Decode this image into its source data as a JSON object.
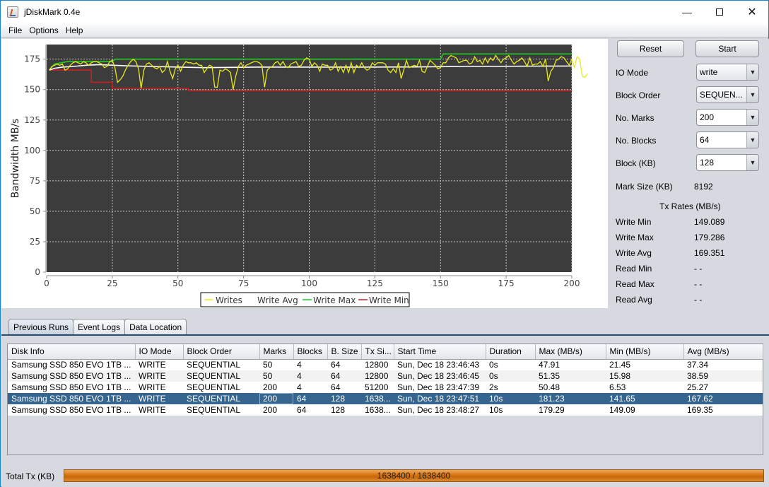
{
  "window": {
    "title": "jDiskMark 0.4e",
    "controls": [
      "minimize",
      "maximize",
      "close"
    ]
  },
  "menu": [
    "File",
    "Options",
    "Help"
  ],
  "controls": {
    "reset_label": "Reset",
    "start_label": "Start",
    "io_mode": {
      "label": "IO Mode",
      "value": "write"
    },
    "block_order": {
      "label": "Block Order",
      "value": "SEQUEN..."
    },
    "no_marks": {
      "label": "No. Marks",
      "value": "200"
    },
    "no_blocks": {
      "label": "No. Blocks",
      "value": "64"
    },
    "block_kb": {
      "label": "Block (KB)",
      "value": "128"
    },
    "mark_size": {
      "label": "Mark Size (KB)",
      "value": "8192"
    },
    "tx_rates_title": "Tx Rates (MB/s)",
    "rates": [
      {
        "label": "Write Min",
        "value": "149.089"
      },
      {
        "label": "Write Max",
        "value": "179.286"
      },
      {
        "label": "Write Avg",
        "value": "169.351"
      },
      {
        "label": "Read Min",
        "value": "- -"
      },
      {
        "label": "Read Max",
        "value": "- -"
      },
      {
        "label": "Read Avg",
        "value": "- -"
      }
    ]
  },
  "tabs": [
    {
      "label": "Previous Runs",
      "active": true
    },
    {
      "label": "Event Logs",
      "active": false
    },
    {
      "label": "Data Location",
      "active": false
    }
  ],
  "table": {
    "columns": [
      "Disk Info",
      "IO Mode",
      "Block Order",
      "Marks",
      "Blocks",
      "B. Size",
      "Tx Si...",
      "Start Time",
      "Duration",
      "Max (MB/s)",
      "Min (MB/s)",
      "Avg (MB/s)"
    ],
    "rows": [
      [
        "Samsung SSD 850 EVO 1TB ...",
        "WRITE",
        "SEQUENTIAL",
        "50",
        "4",
        "64",
        "12800",
        "Sun, Dec 18 23:46:43",
        "0s",
        "47.91",
        "21.45",
        "37.34"
      ],
      [
        "Samsung SSD 850 EVO 1TB ...",
        "WRITE",
        "SEQUENTIAL",
        "50",
        "4",
        "64",
        "12800",
        "Sun, Dec 18 23:46:45",
        "0s",
        "51.35",
        "15.98",
        "38.59"
      ],
      [
        "Samsung SSD 850 EVO 1TB ...",
        "WRITE",
        "SEQUENTIAL",
        "200",
        "4",
        "64",
        "51200",
        "Sun, Dec 18 23:47:39",
        "2s",
        "50.48",
        "6.53",
        "25.27"
      ],
      [
        "Samsung SSD 850 EVO 1TB ...",
        "WRITE",
        "SEQUENTIAL",
        "200",
        "64",
        "128",
        "1638...",
        "Sun, Dec 18 23:47:51",
        "10s",
        "181.23",
        "141.65",
        "167.62"
      ],
      [
        "Samsung SSD 850 EVO 1TB ...",
        "WRITE",
        "SEQUENTIAL",
        "200",
        "64",
        "128",
        "1638...",
        "Sun, Dec 18 23:48:27",
        "10s",
        "179.29",
        "149.09",
        "169.35"
      ]
    ],
    "selected_row": 3
  },
  "footer": {
    "total_label": "Total Tx (KB)",
    "progress_text": "1638400 / 1638400",
    "progress_fraction": 1.0
  },
  "colors": {
    "plot_bg": "#3c3c3c",
    "writes": "#e8e81c",
    "avg": "#ffffff",
    "max": "#22cc22",
    "min": "#cc1f1f",
    "selection": "#36658f",
    "progress": "#d5730f"
  },
  "chart_data": {
    "type": "line",
    "title": "",
    "xlabel": "",
    "ylabel": "Bandwidth MB/s",
    "xlim": [
      0,
      200
    ],
    "ylim": [
      0,
      187
    ],
    "xticks": [
      0,
      25,
      50,
      75,
      100,
      125,
      150,
      175,
      200
    ],
    "yticks": [
      0,
      25,
      50,
      75,
      100,
      125,
      150,
      175
    ],
    "grid": true,
    "legend": {
      "placement": "bottom-center",
      "entries": [
        "Writes",
        "Write Avg",
        "Write Max",
        "Write Min"
      ]
    },
    "series": [
      {
        "name": "Writes",
        "x_start": 1,
        "values": [
          166,
          169,
          170,
          171,
          170,
          171,
          166,
          167,
          170,
          172,
          173,
          172,
          171,
          173,
          172,
          170,
          172,
          173,
          173,
          172,
          171,
          168,
          169,
          173,
          174,
          168,
          156,
          158,
          161,
          166,
          170,
          173,
          175,
          173,
          167,
          151,
          166,
          171,
          172,
          170,
          168,
          167,
          169,
          164,
          166,
          173,
          165,
          159,
          167,
          170,
          165,
          170,
          173,
          172,
          172,
          171,
          172,
          170,
          170,
          164,
          167,
          170,
          169,
          152,
          152,
          166,
          165,
          167,
          166,
          164,
          150,
          161,
          169,
          172,
          168,
          170,
          171,
          172,
          173,
          173,
          172,
          170,
          152,
          166,
          168,
          169,
          172,
          173,
          170,
          173,
          169,
          168,
          171,
          172,
          173,
          169,
          170,
          174,
          176,
          175,
          169,
          172,
          170,
          165,
          171,
          170,
          170,
          166,
          167,
          172,
          165,
          169,
          164,
          170,
          164,
          172,
          164,
          170,
          168,
          172,
          168,
          166,
          167,
          172,
          170,
          172,
          172,
          172,
          171,
          166,
          164,
          167,
          164,
          172,
          159,
          166,
          174,
          168,
          169,
          170,
          169,
          174,
          165,
          164,
          169,
          174,
          172,
          170,
          167,
          168,
          172,
          172,
          176,
          178,
          177,
          176,
          172,
          173,
          174,
          174,
          171,
          172,
          177,
          173,
          174,
          171,
          176,
          172,
          176,
          174,
          178,
          175,
          172,
          175,
          176,
          178,
          174,
          171,
          173,
          174,
          176,
          173,
          169,
          176,
          170,
          171,
          171,
          173,
          169,
          175,
          157,
          165,
          168,
          174,
          175,
          177,
          176,
          173,
          170,
          175,
          168,
          177,
          175,
          161,
          160,
          163
        ]
      },
      {
        "name": "Write Avg",
        "x": [
          1,
          3,
          6,
          10,
          15,
          20,
          30,
          40,
          60,
          80,
          100,
          120,
          140,
          150,
          160,
          180,
          200
        ],
        "values": [
          166,
          167.5,
          168.5,
          169,
          170,
          170.5,
          169.5,
          169,
          168,
          168.5,
          168.5,
          168.5,
          168.6,
          168.8,
          169,
          169.2,
          169.35
        ]
      },
      {
        "name": "Write Max",
        "x": [
          1,
          3,
          8,
          25,
          26,
          150,
          151,
          200
        ],
        "values": [
          166,
          171,
          173,
          173,
          175,
          175,
          179.29,
          179.29
        ]
      },
      {
        "name": "Write Min",
        "x": [
          1,
          17,
          17,
          25,
          25,
          54,
          54,
          200
        ],
        "values": [
          166,
          166,
          156,
          156,
          151,
          151,
          149.09,
          149.09
        ]
      }
    ]
  }
}
